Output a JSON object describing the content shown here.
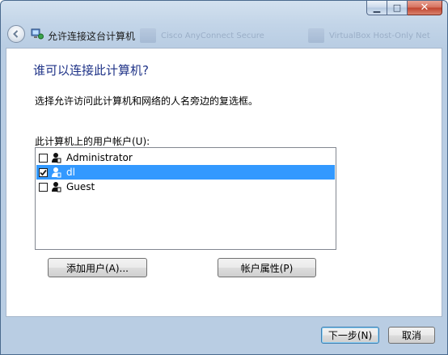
{
  "window": {
    "title": "允许连接这台计算机",
    "background_hints": [
      "Cisco AnyConnect Secure",
      "VirtualBox Host-Only Net"
    ]
  },
  "colors": {
    "heading": "#1e3287",
    "selection": "#3399ff"
  },
  "icons": {
    "back": "back-arrow-icon",
    "nav": "network-computer-icon",
    "user": "user-icon"
  },
  "page": {
    "heading": "谁可以连接此计算机?",
    "description": "选择允许访问此计算机和网络的人名旁边的复选框。",
    "list_label": "此计算机上的用户帐户(U):"
  },
  "users": [
    {
      "name": "Administrator",
      "checked": false,
      "selected": false
    },
    {
      "name": "dl",
      "checked": true,
      "selected": true
    },
    {
      "name": "Guest",
      "checked": false,
      "selected": false
    }
  ],
  "buttons": {
    "add_user": "添加用户(A)...",
    "account_properties": "帐户属性(P)",
    "next": "下一步(N)",
    "cancel": "取消"
  }
}
